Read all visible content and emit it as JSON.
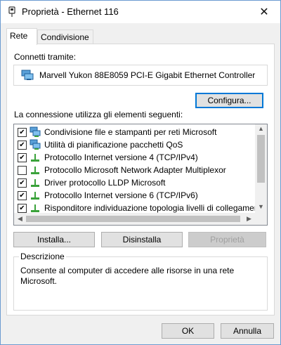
{
  "window": {
    "title": "Proprietà - Ethernet 116",
    "close_glyph": "✕"
  },
  "tabs": [
    {
      "label": "Rete",
      "active": true
    },
    {
      "label": "Condivisione",
      "active": false
    }
  ],
  "connect": {
    "label": "Connetti tramite:",
    "adapter_name": "Marvell Yukon 88E8059 PCI-E Gigabit Ethernet Controller",
    "adapter_icon": "network-adapter-icon"
  },
  "configure_button": "Configura...",
  "items_label": "La connessione utilizza gli elementi seguenti:",
  "items": [
    {
      "label": "Condivisione file e stampanti per reti Microsoft",
      "checked": true,
      "icon": "network-service-icon"
    },
    {
      "label": "Utilità di pianificazione pacchetti QoS",
      "checked": true,
      "icon": "network-service-icon"
    },
    {
      "label": "Protocollo Internet versione 4 (TCP/IPv4)",
      "checked": true,
      "icon": "protocol-icon"
    },
    {
      "label": "Protocollo Microsoft Network Adapter Multiplexor",
      "checked": false,
      "icon": "protocol-icon"
    },
    {
      "label": "Driver protocollo LLDP Microsoft",
      "checked": true,
      "icon": "protocol-icon"
    },
    {
      "label": "Protocollo Internet versione 6 (TCP/IPv6)",
      "checked": true,
      "icon": "protocol-icon"
    },
    {
      "label": "Risponditore individuazione topologia livelli di collegamento",
      "checked": true,
      "icon": "protocol-icon"
    }
  ],
  "buttons": {
    "install": "Installa...",
    "uninstall": "Disinstalla",
    "properties": "Proprietà",
    "ok": "OK",
    "cancel": "Annulla"
  },
  "description": {
    "title": "Descrizione",
    "text": "Consente al computer di accedere alle risorse in una rete Microsoft."
  },
  "colors": {
    "accent": "#0078d7",
    "window_border": "#6b9bd1",
    "dialog_bg": "#f0f0f0",
    "protocol_green": "#3aa23a"
  }
}
